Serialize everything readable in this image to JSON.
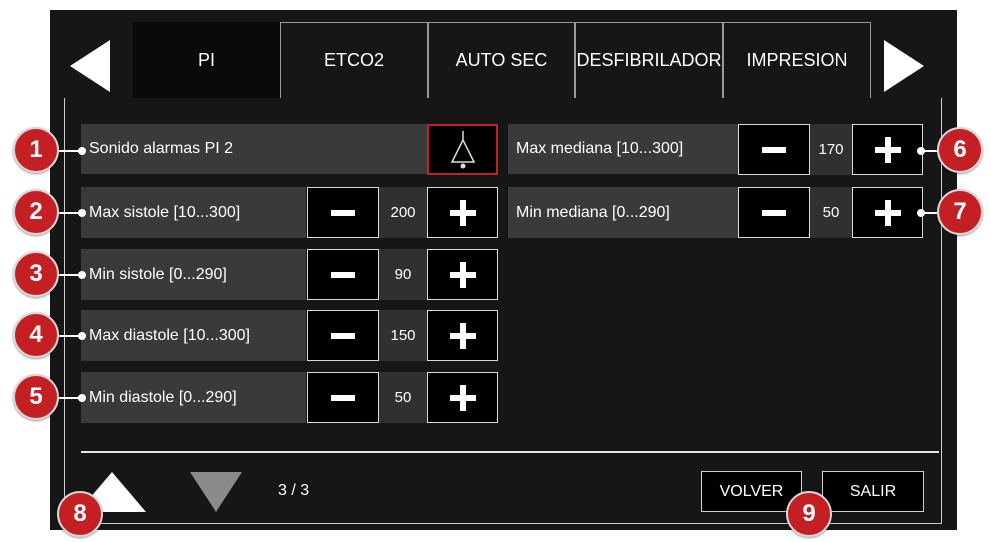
{
  "tabs": [
    {
      "label": "PI",
      "active": true
    },
    {
      "label": "ETCO2",
      "active": false
    },
    {
      "label": "AUTO SEC",
      "active": false
    },
    {
      "label": "DESFIBRILADOR",
      "active": false
    },
    {
      "label": "IMPRESION",
      "active": false
    }
  ],
  "alarm_sound": {
    "label": "Sonido alarmas PI 2",
    "icon": "bell-icon"
  },
  "left_settings": [
    {
      "label": "Max sistole [10...300]",
      "value": "200"
    },
    {
      "label": "Min sistole [0...290]",
      "value": "90"
    },
    {
      "label": "Max diastole [10...300]",
      "value": "150"
    },
    {
      "label": "Min diastole [0...290]",
      "value": "50"
    }
  ],
  "right_settings": [
    {
      "label": "Max mediana [10...300]",
      "value": "170"
    },
    {
      "label": "Min mediana [0...290]",
      "value": "50"
    }
  ],
  "page_indicator": "3 / 3",
  "buttons": {
    "back": "VOLVER",
    "exit": "SALIR"
  },
  "callouts": [
    "1",
    "2",
    "3",
    "4",
    "5",
    "6",
    "7",
    "8",
    "9"
  ],
  "colors": {
    "background": "#161616",
    "row": "#3a3a3a",
    "callout": "#c42024",
    "bell_border": "#c42024"
  }
}
